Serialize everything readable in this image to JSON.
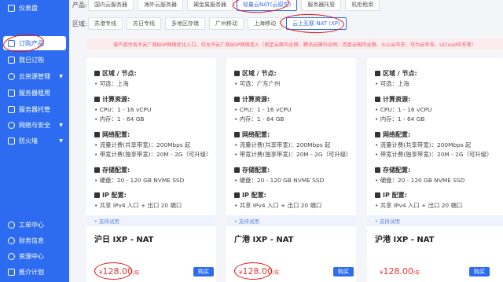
{
  "sidebar": {
    "items": [
      {
        "label": "仪表盘",
        "icon": "dashboard-icon"
      },
      {
        "label": "订购产品",
        "icon": "cart-icon"
      },
      {
        "label": "我已订购",
        "icon": "order-icon"
      },
      {
        "label": "云资源管理",
        "icon": "cloud-icon",
        "has_arrow": true
      },
      {
        "label": "服务器租用",
        "icon": "server-icon"
      },
      {
        "label": "服务器托管",
        "icon": "rack-icon"
      },
      {
        "label": "网络与安全",
        "icon": "network-icon",
        "has_arrow": true
      },
      {
        "label": "防火墙",
        "icon": "firewall-icon",
        "has_arrow": true
      }
    ],
    "bottom_items": [
      {
        "label": "工单中心",
        "icon": "ticket-icon"
      },
      {
        "label": "财务信息",
        "icon": "finance-icon"
      },
      {
        "label": "资源中心",
        "icon": "resource-icon"
      },
      {
        "label": "推介计划",
        "icon": "referral-icon"
      }
    ],
    "active_index": 1
  },
  "filters": {
    "product_label": "产品:",
    "product_options": [
      "国内云服务器",
      "海外云服务器",
      "裸金属服务器",
      "轻量云NAT(云原生)",
      "服务器托管",
      "机柜租用"
    ],
    "product_selected": 3,
    "region_label": "区域:",
    "region_options": [
      "苏港专线",
      "苏日专线",
      "多地区存储",
      "广州移动",
      "上海移动",
      "云上互联 NAT (XP)"
    ],
    "region_selected": 5
  },
  "notice": "该产品为各大云厂商BGP网络优化入口，仅允许云厂商BGP网络连入（例至云原内全网、腾讯云国内全网、百度云国内全网、火山云华东、华为云华东、UCloud华东等）",
  "cards": [
    {
      "region_title": "区域 / 节点:",
      "region_value": "• 可选：上海",
      "compute_title": "计算资源:",
      "cpu": "• CPU：1 - 16 vCPU",
      "memory": "• 内存：1 - 64 GB",
      "network_title": "网络配置:",
      "bw_traffic": "• 流量计费(共享带宽)：200Mbps 起",
      "bw_fixed": "• 带宽计费(独享带宽)：20M - 2G（可升级）",
      "storage_title": "存储配置:",
      "disk": "• 硬盘：20 - 120 GB NVME SSD",
      "ip_title": "IP 配置:",
      "ip": "• 共享 IPv4 入口 + 出口 20 端口",
      "support": "• 支持试用",
      "name": "沪日 IXP - NAT",
      "currency": "¥",
      "price": "128.00",
      "unit": "/年",
      "buy": "购买"
    },
    {
      "region_title": "区域 / 节点:",
      "region_value": "• 可选：广东广州",
      "compute_title": "计算资源:",
      "cpu": "• CPU：1 - 16 vCPU",
      "memory": "• 内存：1 - 64 GB",
      "network_title": "网络配置:",
      "bw_traffic": "• 流量计费(共享带宽)：200Mbps 起",
      "bw_fixed": "• 带宽计费(独享带宽)：20M - 2G（可升级）",
      "storage_title": "存储配置:",
      "disk": "• 硬盘：20 - 120 GB NVME SSD",
      "ip_title": "IP 配置:",
      "ip": "• 共享 IPv4 入口 + 出口 20 端口",
      "support": "• 支持试用",
      "name": "广港 IXP - NAT",
      "currency": "¥",
      "price": "128.00",
      "unit": "/年",
      "buy": "购买"
    },
    {
      "region_title": "区域 / 节点:",
      "region_value": "• 可选：上海",
      "compute_title": "计算资源:",
      "cpu": "• CPU：1 - 16 vCPU",
      "memory": "• 内存：1 - 64 GB",
      "network_title": "网络配置:",
      "bw_traffic": "• 流量计费(共享带宽)：200Mbps 起",
      "bw_fixed": "• 带宽计费(独享带宽)：20M - 2G（可升级）",
      "storage_title": "存储配置:",
      "disk": "• 硬盘：20 - 120 GB NVME SSD",
      "ip_title": "IP 配置:",
      "ip": "• 共享 IPv4 入口 + 出口 20 端口",
      "support": "• 支持试用",
      "name": "沪港 IXP - NAT",
      "currency": "¥",
      "price": "128.00",
      "unit": "/年",
      "buy": "购买"
    }
  ],
  "colors": {
    "brand": "#2d6cf0",
    "price": "#e33",
    "annotation": "#d11"
  }
}
